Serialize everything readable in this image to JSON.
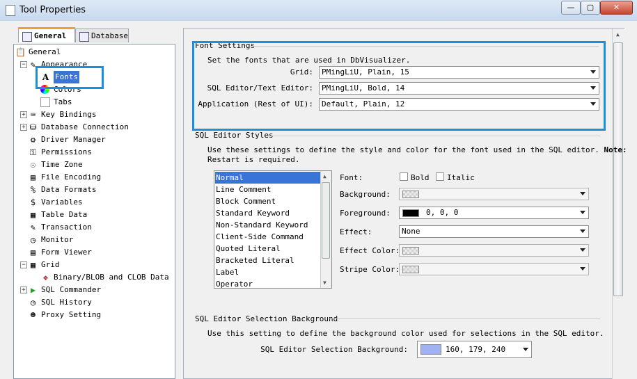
{
  "window": {
    "title": "Tool Properties",
    "min_label": "—",
    "max_label": "▢",
    "close_label": "✕"
  },
  "tabs": [
    {
      "label": "General",
      "icon": "general-tab-icon"
    },
    {
      "label": "Database",
      "icon": "database-tab-icon"
    }
  ],
  "tree": {
    "root": "General",
    "items": [
      {
        "label": "Appearance",
        "icon": "appearance-icon"
      },
      {
        "label": "Fonts",
        "icon": "fonts-icon",
        "selected": true
      },
      {
        "label": "Colors",
        "icon": "colors-icon"
      },
      {
        "label": "Tabs",
        "icon": "tabs-icon"
      },
      {
        "label": "Key Bindings",
        "icon": "keyboard-icon"
      },
      {
        "label": "Database Connection",
        "icon": "database-icon"
      },
      {
        "label": "Driver Manager",
        "icon": "driver-icon"
      },
      {
        "label": "Permissions",
        "icon": "key-icon"
      },
      {
        "label": "Time Zone",
        "icon": "globe-icon"
      },
      {
        "label": "File Encoding",
        "icon": "floppy-icon"
      },
      {
        "label": "Data Formats",
        "icon": "percent-icon"
      },
      {
        "label": "Variables",
        "icon": "dollar-icon"
      },
      {
        "label": "Table Data",
        "icon": "table-icon"
      },
      {
        "label": "Transaction",
        "icon": "transaction-icon"
      },
      {
        "label": "Monitor",
        "icon": "clock-icon"
      },
      {
        "label": "Form Viewer",
        "icon": "form-icon"
      },
      {
        "label": "Grid",
        "icon": "grid-icon"
      },
      {
        "label": "Binary/BLOB and CLOB Data",
        "icon": "blob-icon"
      },
      {
        "label": "SQL Commander",
        "icon": "play-icon"
      },
      {
        "label": "SQL History",
        "icon": "history-icon"
      },
      {
        "label": "Proxy Setting",
        "icon": "proxy-icon"
      }
    ]
  },
  "font_settings": {
    "title": "Font Settings",
    "description": "Set the fonts that are used in DbVisualizer.",
    "rows": [
      {
        "label": "Grid:",
        "value": "PMingLiU, Plain, 15"
      },
      {
        "label": "SQL Editor/Text Editor:",
        "value": "PMingLiU, Bold, 14"
      },
      {
        "label": "Application (Rest of UI):",
        "value": "Default, Plain, 12"
      }
    ]
  },
  "editor_styles": {
    "title": "SQL Editor Styles",
    "description_1": "Use these settings to define the style and color for the font used in the SQL editor.",
    "note_label": "Note:",
    "description_2": "Restart is required.",
    "styles": [
      "Normal",
      "Line Comment",
      "Block Comment",
      "Standard Keyword",
      "Non-Standard Keyword",
      "Client-Side Command",
      "Quoted Literal",
      "Bracketed Literal",
      "Label",
      "Operator"
    ],
    "font_label": "Font:",
    "bold_label": "Bold",
    "italic_label": "Italic",
    "background_label": "Background:",
    "foreground_label": "Foreground:",
    "foreground_value": "0, 0, 0",
    "foreground_color": "#000000",
    "effect_label": "Effect:",
    "effect_value": "None",
    "effect_color_label": "Effect Color:",
    "stripe_color_label": "Stripe Color:"
  },
  "selection_bg": {
    "title": "SQL Editor Selection Background",
    "description": "Use this setting to define the background color used for selections in the SQL editor.",
    "label": "SQL Editor Selection Background:",
    "value": "160, 179, 240",
    "color": "#a0b3f0"
  }
}
